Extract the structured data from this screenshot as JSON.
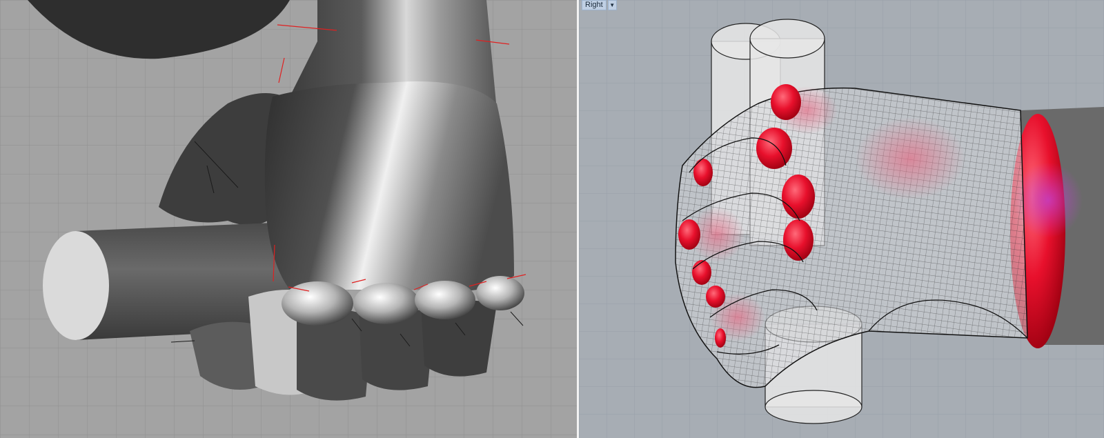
{
  "viewports": {
    "left": {
      "name": "perspective-shaded",
      "label": ""
    },
    "right": {
      "label": "Right",
      "menu_icon": "chevron-down-icon"
    }
  },
  "colors": {
    "left_background": "#a3a3a3",
    "right_background": "#a7adb4",
    "grid_line": "#8f8f8f",
    "right_grid_line": "#97a0a9",
    "splitter": "#f2f2f2",
    "highlight_red": "#e8102c",
    "joint_marker": "#e02020",
    "axis_black": "#1a1a1a"
  }
}
